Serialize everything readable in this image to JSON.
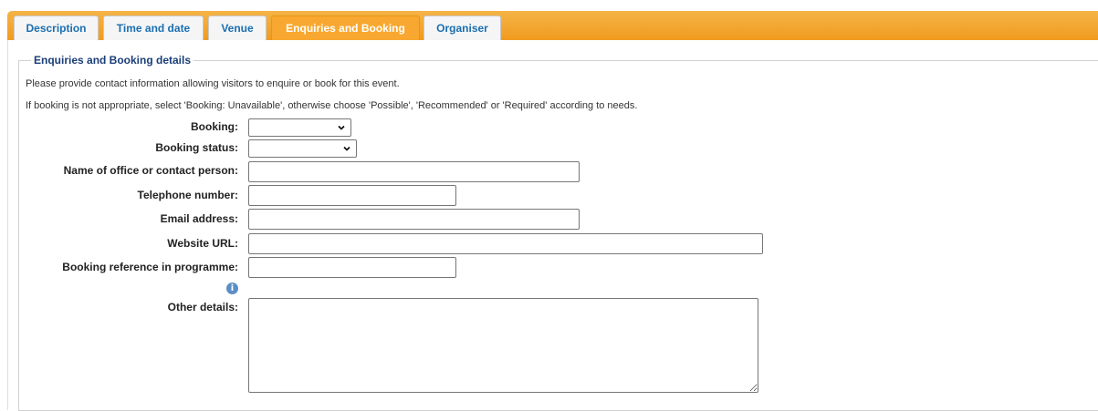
{
  "tabs": [
    {
      "label": "Description"
    },
    {
      "label": "Time and date"
    },
    {
      "label": "Venue"
    },
    {
      "label": "Enquiries and Booking",
      "active": true
    },
    {
      "label": "Organiser"
    }
  ],
  "panel": {
    "legend": "Enquiries and Booking details",
    "intro1": "Please provide contact information allowing visitors to enquire or book for this event.",
    "intro2": "If booking is not appropriate, select 'Booking: Unavailable', otherwise choose 'Possible', 'Recommended' or 'Required' according to needs."
  },
  "fields": {
    "booking": {
      "label": "Booking:",
      "value": ""
    },
    "booking_status": {
      "label": "Booking status:",
      "value": ""
    },
    "contact_name": {
      "label": "Name of office or contact person:",
      "value": ""
    },
    "telephone": {
      "label": "Telephone number:",
      "value": ""
    },
    "email": {
      "label": "Email address:",
      "value": ""
    },
    "website": {
      "label": "Website URL:",
      "value": ""
    },
    "booking_ref": {
      "label": "Booking reference in programme:",
      "value": ""
    },
    "other_details": {
      "label": "Other details:",
      "value": ""
    }
  },
  "icons": {
    "info": "info-icon",
    "dropdown": "chevron-down-icon"
  },
  "colors": {
    "tab_bar": "#f19b1f",
    "tab_active": "#f8a830",
    "tab_text": "#1b6fb0",
    "legend": "#1a3e78"
  }
}
